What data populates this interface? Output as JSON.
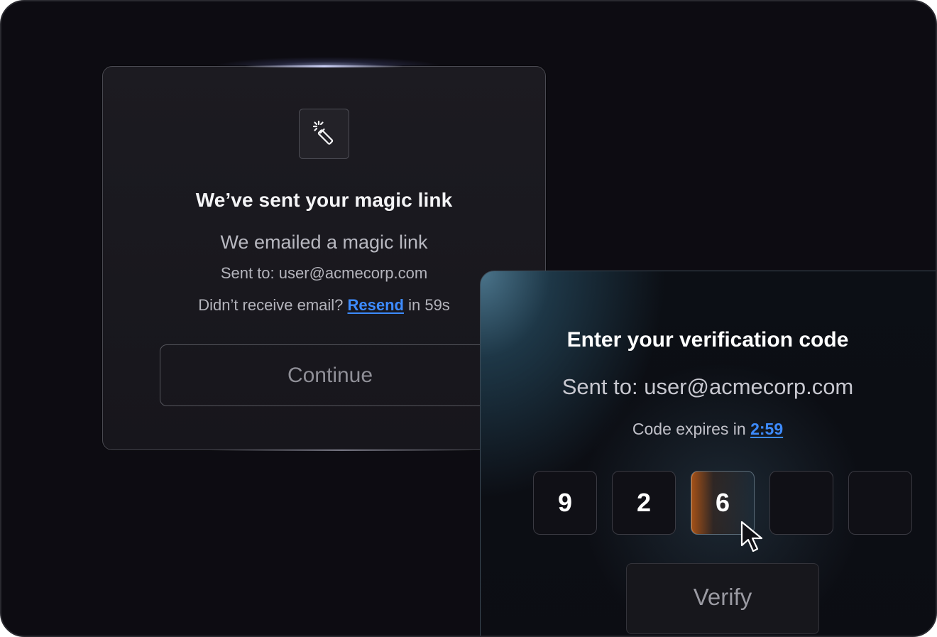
{
  "magic_link_card": {
    "title": "We’ve sent your magic link",
    "subtitle": "We emailed a magic link",
    "sent_to": "Sent to: user@acmecorp.com",
    "resend_prefix": "Didn’t receive email? ",
    "resend_link": "Resend",
    "resend_suffix": " in 59s",
    "continue_label": "Continue",
    "icon": "magic-wand-icon"
  },
  "verification_card": {
    "title": "Enter your verification code",
    "sent_to": "Sent to: user@acmecorp.com",
    "expires_prefix": "Code expires in ",
    "expires_time": "2:59",
    "code_digits": [
      "9",
      "2",
      "6",
      "",
      ""
    ],
    "active_index": 2,
    "verify_label": "Verify"
  },
  "colors": {
    "background": "#0d0c12",
    "accent_link": "#3d8bff",
    "active_digit_glow": "#be5a14",
    "card_teal": "#56869f"
  },
  "cursor": {
    "icon": "mouse-pointer-icon"
  }
}
